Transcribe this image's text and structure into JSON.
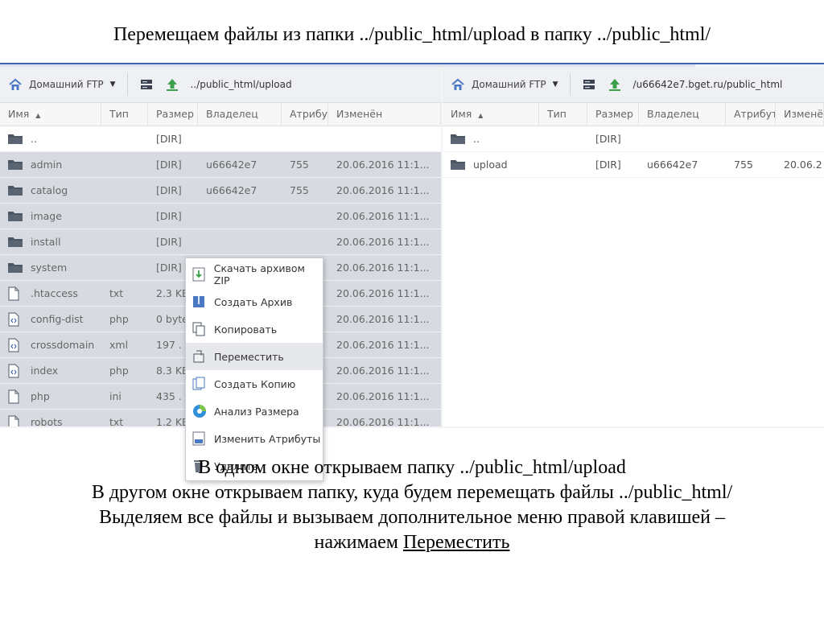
{
  "slide_title": "Перемещаем файлы из папки ../public_html/upload в папку ../public_html/",
  "left_pane": {
    "site_label": "Домашний FTP",
    "path": "../public_html/upload",
    "columns": [
      "Имя",
      "Тип",
      "Размер",
      "Владелец",
      "Атрибут",
      "Изменён"
    ],
    "sort_arrow": "▲",
    "rows": [
      {
        "name": "..",
        "type": "",
        "size": "[DIR]",
        "owner": "",
        "attr": "",
        "modified": "",
        "icon": "folder-icon",
        "selected": false
      },
      {
        "name": "admin",
        "type": "",
        "size": "[DIR]",
        "owner": "u66642e7",
        "attr": "755",
        "modified": "20.06.2016 11:1...",
        "icon": "folder-icon",
        "selected": true
      },
      {
        "name": "catalog",
        "type": "",
        "size": "[DIR]",
        "owner": "u66642e7",
        "attr": "755",
        "modified": "20.06.2016 11:1...",
        "icon": "folder-icon",
        "selected": true
      },
      {
        "name": "image",
        "type": "",
        "size": "[DIR]",
        "owner": "",
        "attr": "",
        "modified": "20.06.2016 11:1...",
        "icon": "folder-icon",
        "selected": true
      },
      {
        "name": "install",
        "type": "",
        "size": "[DIR]",
        "owner": "",
        "attr": "",
        "modified": "20.06.2016 11:1...",
        "icon": "folder-icon",
        "selected": true
      },
      {
        "name": "system",
        "type": "",
        "size": "[DIR]",
        "owner": "",
        "attr": "",
        "modified": "20.06.2016 11:1...",
        "icon": "folder-icon",
        "selected": true
      },
      {
        "name": ".htaccess",
        "type": "txt",
        "size": "2.3 KE",
        "owner": "",
        "attr": "",
        "modified": "20.06.2016 11:1...",
        "icon": "file-icon",
        "selected": true
      },
      {
        "name": "config-dist",
        "type": "php",
        "size": "0 byte",
        "owner": "",
        "attr": "",
        "modified": "20.06.2016 11:1...",
        "icon": "code-file-icon",
        "selected": true
      },
      {
        "name": "crossdomain",
        "type": "xml",
        "size": "197 .",
        "owner": "",
        "attr": "",
        "modified": "20.06.2016 11:1...",
        "icon": "code-file-icon",
        "selected": true
      },
      {
        "name": "index",
        "type": "php",
        "size": "8.3 KE",
        "owner": "",
        "attr": "",
        "modified": "20.06.2016 11:1...",
        "icon": "code-file-icon",
        "selected": true
      },
      {
        "name": "php",
        "type": "ini",
        "size": "435 .",
        "owner": "",
        "attr": "",
        "modified": "20.06.2016 11:1...",
        "icon": "file-icon",
        "selected": true
      },
      {
        "name": "robots",
        "type": "txt",
        "size": "1.2 KE",
        "owner": "",
        "attr": "",
        "modified": "20.06.2016 11:1...",
        "icon": "file-icon",
        "selected": true
      }
    ]
  },
  "right_pane": {
    "site_label": "Домашний FTP",
    "path": "/u66642e7.bget.ru/public_html",
    "columns": [
      "Имя",
      "Тип",
      "Размер",
      "Владелец",
      "Атрибут",
      "Изменён"
    ],
    "sort_arrow": "▲",
    "rows": [
      {
        "name": "..",
        "type": "",
        "size": "[DIR]",
        "owner": "",
        "attr": "",
        "modified": "",
        "icon": "folder-icon"
      },
      {
        "name": "upload",
        "type": "",
        "size": "[DIR]",
        "owner": "u66642e7",
        "attr": "755",
        "modified": "20.06.2",
        "icon": "folder-icon"
      }
    ]
  },
  "context_menu": {
    "items": [
      {
        "label": "Скачать архивом ZIP",
        "icon": "download-zip-icon",
        "highlighted": false
      },
      {
        "label": "Создать Архив",
        "icon": "archive-icon",
        "highlighted": false
      },
      {
        "label": "Копировать",
        "icon": "copy-icon",
        "highlighted": false
      },
      {
        "label": "Переместить",
        "icon": "move-icon",
        "highlighted": true
      },
      {
        "label": "Создать Копию",
        "icon": "duplicate-icon",
        "highlighted": false
      },
      {
        "label": "Анализ Размера",
        "icon": "size-analysis-icon",
        "highlighted": false
      },
      {
        "label": "Изменить Атрибуты",
        "icon": "attributes-icon",
        "highlighted": false
      },
      {
        "label": "Удалить",
        "icon": "trash-icon",
        "highlighted": false
      }
    ]
  },
  "caption": {
    "line1": "В одном окне открываем папку ../public_html/upload",
    "line2": "В другом окне открываем папку, куда будем перемещать файлы ../public_html/",
    "line3": "Выделяем все файлы и вызываем дополнительное меню правой клавишей –",
    "line4_prefix": "нажимаем ",
    "line4_link": "Переместить"
  },
  "colors": {
    "selection": "#d7dae0",
    "accent_border": "#3f63b8",
    "home_icon": "#4a78c2",
    "upload_arrow": "#3aa14a"
  }
}
